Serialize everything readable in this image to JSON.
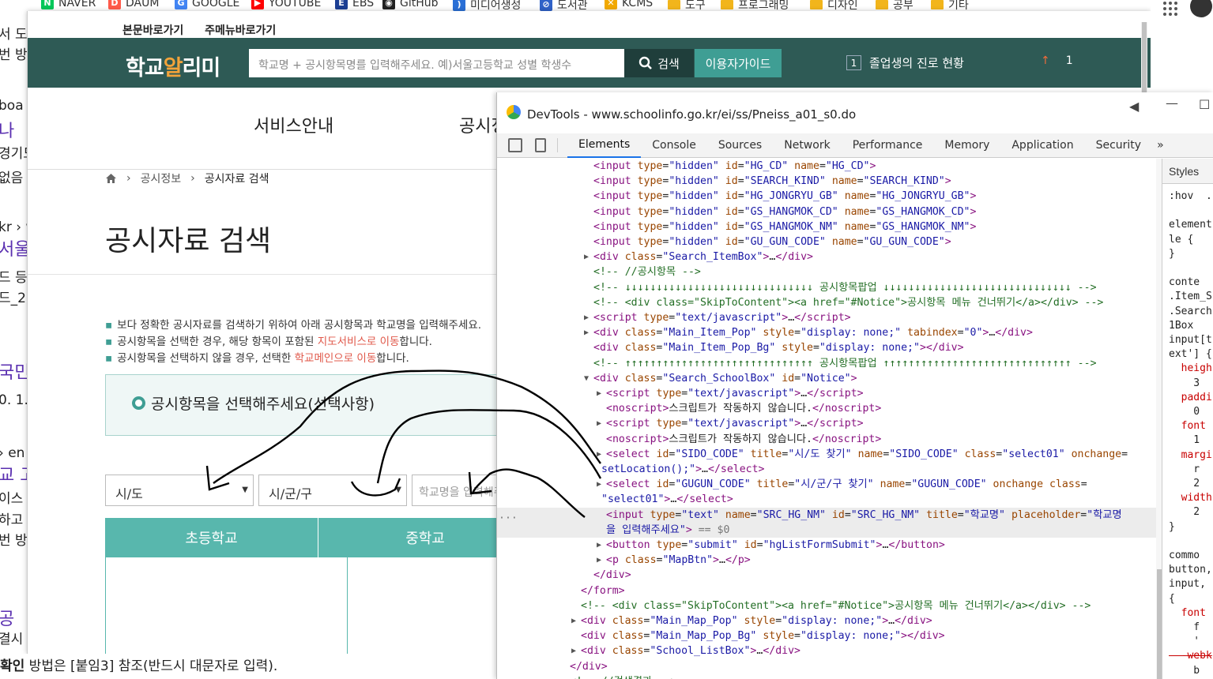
{
  "bookmarks": {
    "items": [
      {
        "label": "NAVER",
        "icon": "naver-icon",
        "color": "#03c75a",
        "glyph": "N"
      },
      {
        "label": "DAUM",
        "icon": "daum-icon",
        "color": "#ff5a4a",
        "glyph": "D"
      },
      {
        "label": "GOOGLE",
        "icon": "google-icon",
        "color": "#4285f4",
        "glyph": "G"
      },
      {
        "label": "YOUTUBE",
        "icon": "youtube-icon",
        "color": "#ff0000",
        "glyph": "▶"
      },
      {
        "label": "EBS",
        "icon": "ebs-icon",
        "color": "#1c3f94",
        "glyph": "E"
      },
      {
        "label": "GitHub",
        "icon": "github-icon",
        "color": "#222222",
        "glyph": "◉"
      },
      {
        "label": "미디어생성",
        "icon": "media-icon",
        "color": "#2a6fd6",
        "glyph": ")"
      },
      {
        "label": "도서관",
        "icon": "library-icon",
        "color": "#3062c8",
        "glyph": "⊘"
      },
      {
        "label": "KCMS",
        "icon": "kcms-icon",
        "color": "#f2a900",
        "glyph": "✕"
      },
      {
        "label": "도구",
        "icon": "folder-icon"
      },
      {
        "label": "프로그래밍",
        "icon": "folder-icon"
      },
      {
        "label": "디자인",
        "icon": "folder-icon"
      },
      {
        "label": "공부",
        "icon": "folder-icon"
      },
      {
        "label": "기타",
        "icon": "folder-icon"
      }
    ]
  },
  "background_page": {
    "fragments": [
      "서 도",
      "번 방",
      "boa",
      "나",
      "경기도",
      "없음",
      "kr › w",
      "서울",
      "드 등",
      "드_2",
      "국민",
      "0. 1.",
      "› en",
      "교 고",
      "이스",
      "하고",
      "번 방",
      "공",
      "결시"
    ],
    "bottom_text_bold": "확인",
    "bottom_text": " 방법은 [붙임3] 참조(반드시 대문자로 입력)."
  },
  "site": {
    "skip_links": [
      "본문바로가기",
      "주메뉴바로가기"
    ],
    "logo": {
      "part1": "학교",
      "part2": "알",
      "part3": "리미"
    },
    "search_placeholder": "학교명 + 공시항목명를 입력해주세요. 예)서울고등학교 성별 학생수",
    "search_button": "검색",
    "guide_button": "이용자가이드",
    "ticker_num": "1",
    "ticker_text": "졸업생의 진로 현황",
    "rank_arrow": "↑",
    "rank_value": "1",
    "menu": [
      "서비스안내",
      "공시정"
    ],
    "breadcrumb": [
      "공시정보",
      "공시자료 검색"
    ],
    "title": "공시자료 검색",
    "notes": [
      {
        "text": "보다 정확한 공시자료를 검색하기 위하여 아래 공시항목과 학교명을 입력해주세요."
      },
      {
        "pre": "공시항목을 선택한 경우, 해당 항목이 포함된 ",
        "link": "지도서비스로 이동",
        "post": "합니다."
      },
      {
        "pre": "공시항목을 선택하지 않을 경우, 선택한 ",
        "link": "학교메인으로 이동",
        "post": "합니다."
      }
    ],
    "item_select_label": "공시항목을 선택해주세요(선택사항)",
    "sido_select": "시/도",
    "gugun_select": "시/군/구",
    "school_placeholder": "학교명을 입력해주세요",
    "tabs": [
      "초등학교",
      "중학교"
    ],
    "accent": "#3f9e94",
    "header_color": "#2e5a55"
  },
  "devtools": {
    "title": "DevTools - www.schoolinfo.go.kr/ei/ss/Pneiss_a01_s0.do",
    "tabs": [
      "Elements",
      "Console",
      "Sources",
      "Network",
      "Performance",
      "Memory",
      "Application",
      "Security"
    ],
    "more": "»",
    "styles_header": "Styles",
    "styles_lines": [
      ":hov  .",
      "",
      "element",
      "le {",
      "}",
      "",
      "conte",
      ".Item_S",
      ".Search",
      "1Box",
      "input[t",
      "ext'] {",
      "  heigh",
      "    3",
      "  paddi",
      "    0",
      "  font",
      "    1",
      "  margi",
      "    r",
      "    2",
      "  width",
      "    2",
      "}",
      "",
      "commo",
      "button,",
      "input,",
      "{",
      "  font",
      "    f",
      "    '",
      "  -webk",
      "    b",
      "    -"
    ],
    "code_lines": [
      {
        "i": 122,
        "h": "<span class=\"tg\">&lt;input</span> <span class=\"at\">type</span>=<span class=\"av\">\"hidden\"</span> <span class=\"at\">id</span>=<span class=\"av\">\"HG_CD\"</span> <span class=\"at\">name</span>=<span class=\"av\">\"HG_CD\"</span><span class=\"tg\">&gt;</span>"
      },
      {
        "i": 122,
        "h": "<span class=\"tg\">&lt;input</span> <span class=\"at\">type</span>=<span class=\"av\">\"hidden\"</span> <span class=\"at\">id</span>=<span class=\"av\">\"SEARCH_KIND\"</span> <span class=\"at\">name</span>=<span class=\"av\">\"SEARCH_KIND\"</span><span class=\"tg\">&gt;</span>"
      },
      {
        "i": 122,
        "h": "<span class=\"tg\">&lt;input</span> <span class=\"at\">type</span>=<span class=\"av\">\"hidden\"</span> <span class=\"at\">id</span>=<span class=\"av\">\"HG_JONGRYU_GB\"</span> <span class=\"at\">name</span>=<span class=\"av\">\"HG_JONGRYU_GB\"</span><span class=\"tg\">&gt;</span>"
      },
      {
        "i": 122,
        "h": "<span class=\"tg\">&lt;input</span> <span class=\"at\">type</span>=<span class=\"av\">\"hidden\"</span> <span class=\"at\">id</span>=<span class=\"av\">\"GS_HANGMOK_CD\"</span> <span class=\"at\">name</span>=<span class=\"av\">\"GS_HANGMOK_CD\"</span><span class=\"tg\">&gt;</span>"
      },
      {
        "i": 122,
        "h": "<span class=\"tg\">&lt;input</span> <span class=\"at\">type</span>=<span class=\"av\">\"hidden\"</span> <span class=\"at\">id</span>=<span class=\"av\">\"GS_HANGMOK_NM\"</span> <span class=\"at\">name</span>=<span class=\"av\">\"GS_HANGMOK_NM\"</span><span class=\"tg\">&gt;</span>"
      },
      {
        "i": 122,
        "h": "<span class=\"tg\">&lt;input</span> <span class=\"at\">type</span>=<span class=\"av\">\"hidden\"</span> <span class=\"at\">id</span>=<span class=\"av\">\"GU_GUN_CODE\"</span> <span class=\"at\">name</span>=<span class=\"av\">\"GU_GUN_CODE\"</span><span class=\"tg\">&gt;</span>"
      },
      {
        "i": 122,
        "t": 1,
        "h": "<span class=\"tg\">&lt;div</span> <span class=\"at\">class</span>=<span class=\"av\">\"Search_ItemBox\"</span><span class=\"tg\">&gt;</span>…<span class=\"tg\">&lt;/div&gt;</span>"
      },
      {
        "i": 122,
        "h": "<span class=\"cm\">&lt;!-- //공시항목 --&gt;</span>"
      },
      {
        "i": 122,
        "h": "<span class=\"cm\">&lt;!-- ↓↓↓↓↓↓↓↓↓↓↓↓↓↓↓↓↓↓↓↓↓↓↓↓↓↓↓↓↓↓ 공시항목팝업 ↓↓↓↓↓↓↓↓↓↓↓↓↓↓↓↓↓↓↓↓↓↓↓↓↓↓↓↓↓↓ --&gt;</span>"
      },
      {
        "i": 122,
        "h": "<span class=\"cm\">&lt;!-- &lt;div class=\"SkipToContent\"&gt;&lt;a href=\"#Notice\"&gt;공시항목 메뉴 건너뛰기&lt;/a&gt;&lt;/div&gt; --&gt;</span>"
      },
      {
        "i": 122,
        "t": 1,
        "h": "<span class=\"tg\">&lt;script</span> <span class=\"at\">type</span>=<span class=\"av\">\"text/javascript\"</span><span class=\"tg\">&gt;</span>…<span class=\"tg\">&lt;/script&gt;</span>"
      },
      {
        "i": 122,
        "t": 1,
        "h": "<span class=\"tg\">&lt;div</span> <span class=\"at\">class</span>=<span class=\"av\">\"Main_Item_Pop\"</span> <span class=\"at\">style</span>=<span class=\"av\">\"display: none;\"</span> <span class=\"at\">tabindex</span>=<span class=\"av\">\"0\"</span><span class=\"tg\">&gt;</span>…<span class=\"tg\">&lt;/div&gt;</span>"
      },
      {
        "i": 122,
        "h": "<span class=\"tg\">&lt;div</span> <span class=\"at\">class</span>=<span class=\"av\">\"Main_Item_Pop_Bg\"</span> <span class=\"at\">style</span>=<span class=\"av\">\"display: none;\"</span><span class=\"tg\">&gt;&lt;/div&gt;</span>"
      },
      {
        "i": 122,
        "h": "<span class=\"cm\">&lt;!-- ↑↑↑↑↑↑↑↑↑↑↑↑↑↑↑↑↑↑↑↑↑↑↑↑↑↑↑↑↑↑ 공시항목팝업 ↑↑↑↑↑↑↑↑↑↑↑↑↑↑↑↑↑↑↑↑↑↑↑↑↑↑↑↑↑↑ --&gt;</span>"
      },
      {
        "i": 122,
        "t": 2,
        "h": "<span class=\"tg\">&lt;div</span> <span class=\"at\">class</span>=<span class=\"av\">\"Search_SchoolBox\"</span> <span class=\"at\">id</span>=<span class=\"av\">\"Notice\"</span><span class=\"tg\">&gt;</span>"
      },
      {
        "i": 138,
        "t": 1,
        "h": "<span class=\"tg\">&lt;script</span> <span class=\"at\">type</span>=<span class=\"av\">\"text/javascript\"</span><span class=\"tg\">&gt;</span>…<span class=\"tg\">&lt;/script&gt;</span>"
      },
      {
        "i": 138,
        "h": "<span class=\"tg\">&lt;noscript&gt;</span><span class=\"tx\">스크립트가 작동하지 않습니다.</span><span class=\"tg\">&lt;/noscript&gt;</span>"
      },
      {
        "i": 138,
        "t": 1,
        "h": "<span class=\"tg\">&lt;script</span> <span class=\"at\">type</span>=<span class=\"av\">\"text/javascript\"</span><span class=\"tg\">&gt;</span>…<span class=\"tg\">&lt;/script&gt;</span>"
      },
      {
        "i": 138,
        "h": "<span class=\"tg\">&lt;noscript&gt;</span><span class=\"tx\">스크립트가 작동하지 않습니다.</span><span class=\"tg\">&lt;/noscript&gt;</span>"
      },
      {
        "i": 138,
        "t": 1,
        "h": "<span class=\"tg\">&lt;select</span> <span class=\"at\">id</span>=<span class=\"av\">\"SIDO_CODE\"</span> <span class=\"at\">title</span>=<span class=\"av\">\"시/도 찾기\"</span> <span class=\"at\">name</span>=<span class=\"av\">\"SIDO_CODE\"</span> <span class=\"at\">class</span>=<span class=\"av\">\"select01\"</span> <span class=\"at\">onchange</span>="
      },
      {
        "i": 132,
        "h": "<span class=\"av\">setLocation();\"</span><span class=\"tg\">&gt;</span>…<span class=\"tg\">&lt;/select&gt;</span>"
      },
      {
        "i": 138,
        "t": 1,
        "h": "<span class=\"tg\">&lt;select</span> <span class=\"at\">id</span>=<span class=\"av\">\"GUGUN_CODE\"</span> <span class=\"at\">title</span>=<span class=\"av\">\"시/군/구 찾기\"</span> <span class=\"at\">name</span>=<span class=\"av\">\"GUGUN_CODE\"</span> <span class=\"at\">onchange</span> <span class=\"at\">class</span>="
      },
      {
        "i": 132,
        "h": "<span class=\"av\">\"select01\"</span><span class=\"tg\">&gt;</span>…<span class=\"tg\">&lt;/select&gt;</span>"
      },
      {
        "i": 138,
        "hl": 1,
        "h": "<span class=\"tg\">&lt;input</span> <span class=\"at\">type</span>=<span class=\"av\">\"text\"</span> <span class=\"at\">name</span>=<span class=\"av\">\"SRC_HG_NM\"</span> <span class=\"at\">id</span>=<span class=\"av\">\"SRC_HG_NM\"</span> <span class=\"at\">title</span>=<span class=\"av\">\"학교명\"</span> <span class=\"at\">placeholder</span>=<span class=\"av\">\"학교명</span>"
      },
      {
        "i": 138,
        "hl": 1,
        "h": "<span class=\"av\">을 입력해주세요\"</span><span class=\"tg\">&gt;</span> <span style=\"color:#777\">== $0</span>"
      },
      {
        "i": 138,
        "t": 1,
        "h": "<span class=\"tg\">&lt;button</span> <span class=\"at\">type</span>=<span class=\"av\">\"submit\"</span> <span class=\"at\">id</span>=<span class=\"av\">\"hgListFormSubmit\"</span><span class=\"tg\">&gt;</span>…<span class=\"tg\">&lt;/button&gt;</span>"
      },
      {
        "i": 138,
        "t": 1,
        "h": "<span class=\"tg\">&lt;p</span> <span class=\"at\">class</span>=<span class=\"av\">\"MapBtn\"</span><span class=\"tg\">&gt;</span>…<span class=\"tg\">&lt;/p&gt;</span>"
      },
      {
        "i": 122,
        "h": "<span class=\"tg\">&lt;/div&gt;</span>"
      },
      {
        "i": 106,
        "h": "<span class=\"tg\">&lt;/form&gt;</span>"
      },
      {
        "i": 106,
        "h": "<span class=\"cm\">&lt;!-- &lt;div class=\"SkipToContent\"&gt;&lt;a href=\"#Notice\"&gt;공시항목 메뉴 건너뛰기&lt;/a&gt;&lt;/div&gt; --&gt;</span>"
      },
      {
        "i": 106,
        "t": 1,
        "h": "<span class=\"tg\">&lt;div</span> <span class=\"at\">class</span>=<span class=\"av\">\"Main_Map_Pop\"</span> <span class=\"at\">style</span>=<span class=\"av\">\"display: none;\"</span><span class=\"tg\">&gt;</span>…<span class=\"tg\">&lt;/div&gt;</span>"
      },
      {
        "i": 106,
        "h": "<span class=\"tg\">&lt;div</span> <span class=\"at\">class</span>=<span class=\"av\">\"Main_Map_Pop_Bg\"</span> <span class=\"at\">style</span>=<span class=\"av\">\"display: none;\"</span><span class=\"tg\">&gt;&lt;/div&gt;</span>"
      },
      {
        "i": 106,
        "t": 1,
        "h": "<span class=\"tg\">&lt;div</span> <span class=\"at\">class</span>=<span class=\"av\">\"School_ListBox\"</span><span class=\"tg\">&gt;</span>…<span class=\"tg\">&lt;/div&gt;</span>"
      },
      {
        "i": 92,
        "h": "<span class=\"tg\">&lt;/div&gt;</span>"
      },
      {
        "i": 92,
        "h": "<span class=\"cm\">&lt;!-- //검색결과 --&gt;</span>"
      }
    ]
  }
}
